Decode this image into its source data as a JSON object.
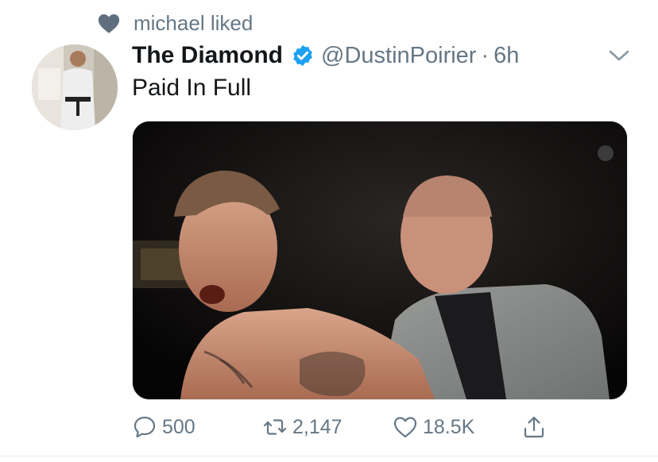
{
  "social_context": {
    "icon": "heart-icon",
    "text": "michael liked"
  },
  "tweet": {
    "author_name": "The Diamond",
    "verified": true,
    "handle": "@DustinPoirier",
    "separator": "·",
    "time": "6h",
    "text": "Paid In Full",
    "media_description_icon": "photo"
  },
  "actions": {
    "reply_count": "500",
    "retweet_count": "2,147",
    "like_count": "18.5K"
  },
  "colors": {
    "text_primary": "#14171a",
    "text_secondary": "#657786",
    "verified_blue": "#1da1f2",
    "icon_gray": "#657786"
  }
}
